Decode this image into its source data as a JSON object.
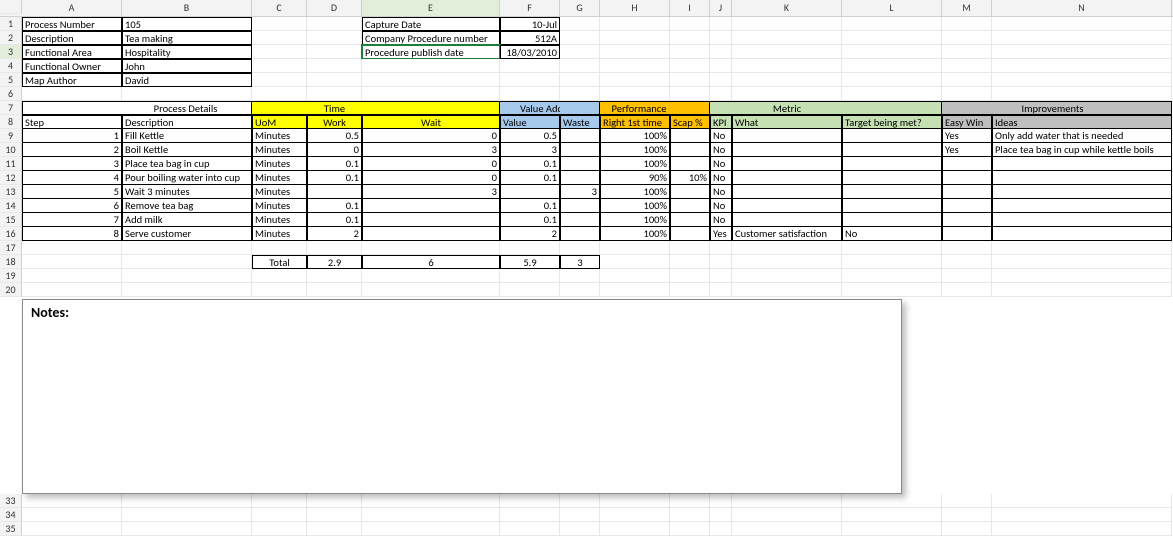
{
  "columns": [
    "A",
    "B",
    "C",
    "D",
    "E",
    "F",
    "G",
    "H",
    "I",
    "J",
    "K",
    "L",
    "M",
    "N"
  ],
  "rowCount": 35,
  "selected": {
    "col": "E",
    "row": 3
  },
  "meta": {
    "r1": {
      "A": "Process  Number",
      "B": "105",
      "E": "Capture Date",
      "F": "10-Jul"
    },
    "r2": {
      "A": "Description",
      "B": "Tea making",
      "E": "Company Procedure number",
      "F": "512A"
    },
    "r3": {
      "A": "Functional Area",
      "B": "Hospitality",
      "E": "Procedure publish date",
      "F": "18/03/2010"
    },
    "r4": {
      "A": "Functional Owner",
      "B": "John"
    },
    "r5": {
      "A": "Map Author",
      "B": "David"
    }
  },
  "group_headers": {
    "process": "Process Details",
    "time": "Time",
    "valueadd": "Value Add",
    "performance": "Performance",
    "metric": "Metric",
    "improvements": "Improvements"
  },
  "col_headers": {
    "A": "Step",
    "B": "Description",
    "C": "UoM",
    "D": "Work",
    "E": "Wait",
    "F": "Value",
    "G": "Waste",
    "H": "Right 1st time",
    "I": "Scap %",
    "J": "KPI",
    "K": "What",
    "L": "Target being met?",
    "M": "Easy Win",
    "N": "Ideas"
  },
  "data_rows": [
    {
      "A": "1",
      "B": "Fill Kettle",
      "C": "Minutes",
      "D": "0.5",
      "E": "0",
      "F": "0.5",
      "G": "",
      "H": "100%",
      "I": "",
      "J": "No",
      "K": "",
      "L": "",
      "M": "Yes",
      "N": "Only add water that is needed"
    },
    {
      "A": "2",
      "B": "Boil Kettle",
      "C": "Minutes",
      "D": "0",
      "E": "3",
      "F": "3",
      "G": "",
      "H": "100%",
      "I": "",
      "J": "No",
      "K": "",
      "L": "",
      "M": "Yes",
      "N": "Place tea bag in cup while kettle boils"
    },
    {
      "A": "3",
      "B": "Place tea bag in cup",
      "C": "Minutes",
      "D": "0.1",
      "E": "0",
      "F": "0.1",
      "G": "",
      "H": "100%",
      "I": "",
      "J": "No",
      "K": "",
      "L": "",
      "M": "",
      "N": ""
    },
    {
      "A": "4",
      "B": "Pour boiling water into cup",
      "C": "Minutes",
      "D": "0.1",
      "E": "0",
      "F": "0.1",
      "G": "",
      "H": "90%",
      "I": "10%",
      "J": "No",
      "K": "",
      "L": "",
      "M": "",
      "N": ""
    },
    {
      "A": "5",
      "B": "Wait 3 minutes",
      "C": "Minutes",
      "D": "",
      "E": "3",
      "F": "",
      "G": "3",
      "H": "100%",
      "I": "",
      "J": "No",
      "K": "",
      "L": "",
      "M": "",
      "N": ""
    },
    {
      "A": "6",
      "B": "Remove tea bag",
      "C": "Minutes",
      "D": "0.1",
      "E": "",
      "F": "0.1",
      "G": "",
      "H": "100%",
      "I": "",
      "J": "No",
      "K": "",
      "L": "",
      "M": "",
      "N": ""
    },
    {
      "A": "7",
      "B": "Add milk",
      "C": "Minutes",
      "D": "0.1",
      "E": "",
      "F": "0.1",
      "G": "",
      "H": "100%",
      "I": "",
      "J": "No",
      "K": "",
      "L": "",
      "M": "",
      "N": ""
    },
    {
      "A": "8",
      "B": "Serve customer",
      "C": "Minutes",
      "D": "2",
      "E": "",
      "F": "2",
      "G": "",
      "H": "100%",
      "I": "",
      "J": "Yes",
      "K": "Customer satisfaction",
      "L": "No",
      "M": "",
      "N": ""
    }
  ],
  "totals": {
    "label": "Total",
    "D": "2.9",
    "E": "6",
    "F": "5.9",
    "G": "3"
  },
  "notes_label": "Notes:"
}
